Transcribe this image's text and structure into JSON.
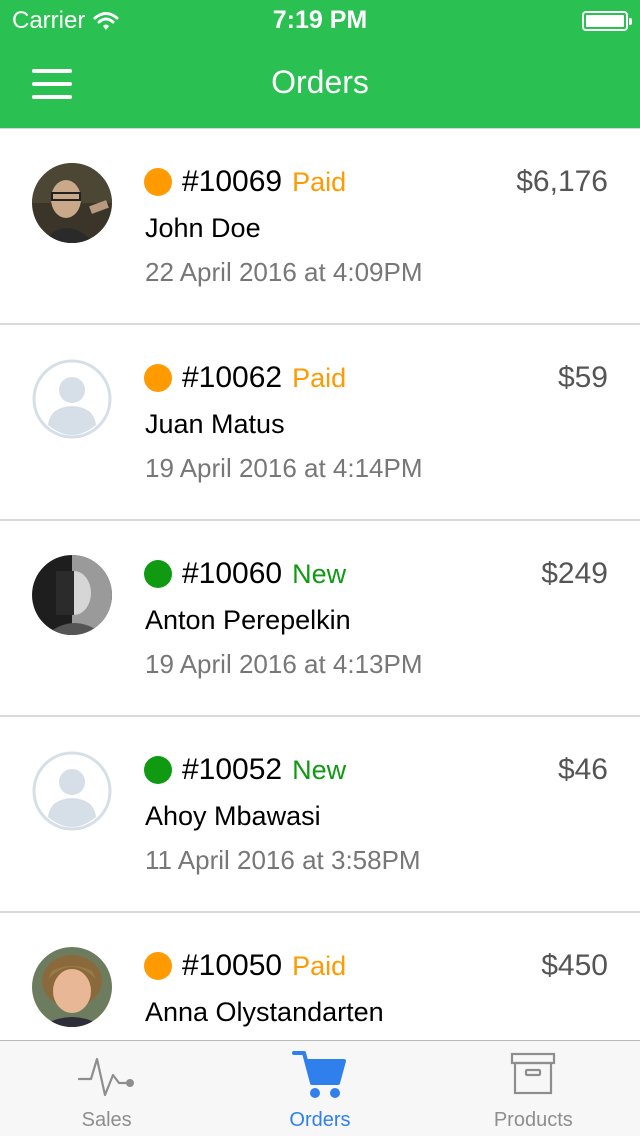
{
  "status_bar": {
    "carrier": "Carrier",
    "time": "7:19 PM"
  },
  "nav": {
    "title": "Orders"
  },
  "colors": {
    "header": "#2ac052",
    "paid": "#ff9a00",
    "new": "#0f9a12",
    "active_tab": "#2f80ed"
  },
  "orders": [
    {
      "number": "#10069",
      "status": "Paid",
      "amount": "$6,176",
      "customer": "John Doe",
      "date": "22 April 2016 at 4:09PM",
      "avatar": "photo"
    },
    {
      "number": "#10062",
      "status": "Paid",
      "amount": "$59",
      "customer": "Juan Matus",
      "date": "19 April 2016 at 4:14PM",
      "avatar": "placeholder"
    },
    {
      "number": "#10060",
      "status": "New",
      "amount": "$249",
      "customer": "Anton Perepelkin",
      "date": "19 April 2016 at 4:13PM",
      "avatar": "photo"
    },
    {
      "number": "#10052",
      "status": "New",
      "amount": "$46",
      "customer": "Ahoy Mbawasi",
      "date": "11 April 2016 at 3:58PM",
      "avatar": "placeholder"
    },
    {
      "number": "#10050",
      "status": "Paid",
      "amount": "$450",
      "customer": "Anna Olystandarten",
      "date": "",
      "avatar": "photo"
    }
  ],
  "tabs": [
    {
      "label": "Sales",
      "icon": "pulse-icon",
      "active": false
    },
    {
      "label": "Orders",
      "icon": "cart-icon",
      "active": true
    },
    {
      "label": "Products",
      "icon": "archive-box-icon",
      "active": false
    }
  ]
}
